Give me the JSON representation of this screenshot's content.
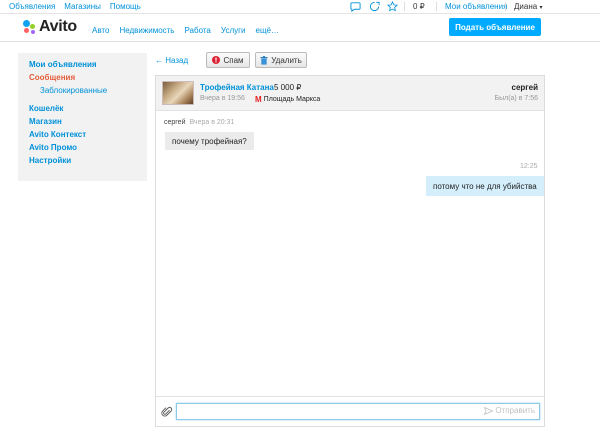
{
  "topbar": {
    "links": [
      "Объявления",
      "Магазины",
      "Помощь"
    ],
    "balance": "0 ₽",
    "my_ads": "Мои объявления",
    "user": "Диана"
  },
  "header": {
    "logo_text": "Avito",
    "nav": [
      "Авто",
      "Недвижимость",
      "Работа",
      "Услуги",
      "ещё…"
    ],
    "post_button": "Подать объявление"
  },
  "sidebar": {
    "items": [
      {
        "label": "Мои объявления",
        "active": false
      },
      {
        "label": "Сообщения",
        "active": true
      },
      {
        "label": "Заблокированные",
        "sub": true
      },
      {
        "label": "Кошелёк",
        "active": false
      },
      {
        "label": "Магазин",
        "active": false
      },
      {
        "label": "Avito Контекст",
        "active": false
      },
      {
        "label": "Avito Промо",
        "active": false
      },
      {
        "label": "Настройки",
        "active": false
      }
    ]
  },
  "toolbar": {
    "back": "← Назад",
    "spam": "Спам",
    "delete": "Удалить"
  },
  "ad": {
    "title": "Трофейная Катана",
    "price": "5 000 ₽",
    "time": "Вчера в 19:56",
    "metro_icon": "М",
    "metro": "Площадь Маркса"
  },
  "partner": {
    "name": "сергей",
    "seen": "Был(а) в 7:56"
  },
  "messages": {
    "incoming": {
      "author": "сергей",
      "time": "Вчера в 20:31",
      "text": "почему трофейная?"
    },
    "outgoing": {
      "time": "12:25",
      "text": "потому что не для убийства"
    }
  },
  "composer": {
    "value": "",
    "placeholder": "",
    "send_label": "Отправить"
  },
  "colors": {
    "link": "#0091d9",
    "accent": "#00aaff",
    "active": "#e55e3b"
  }
}
